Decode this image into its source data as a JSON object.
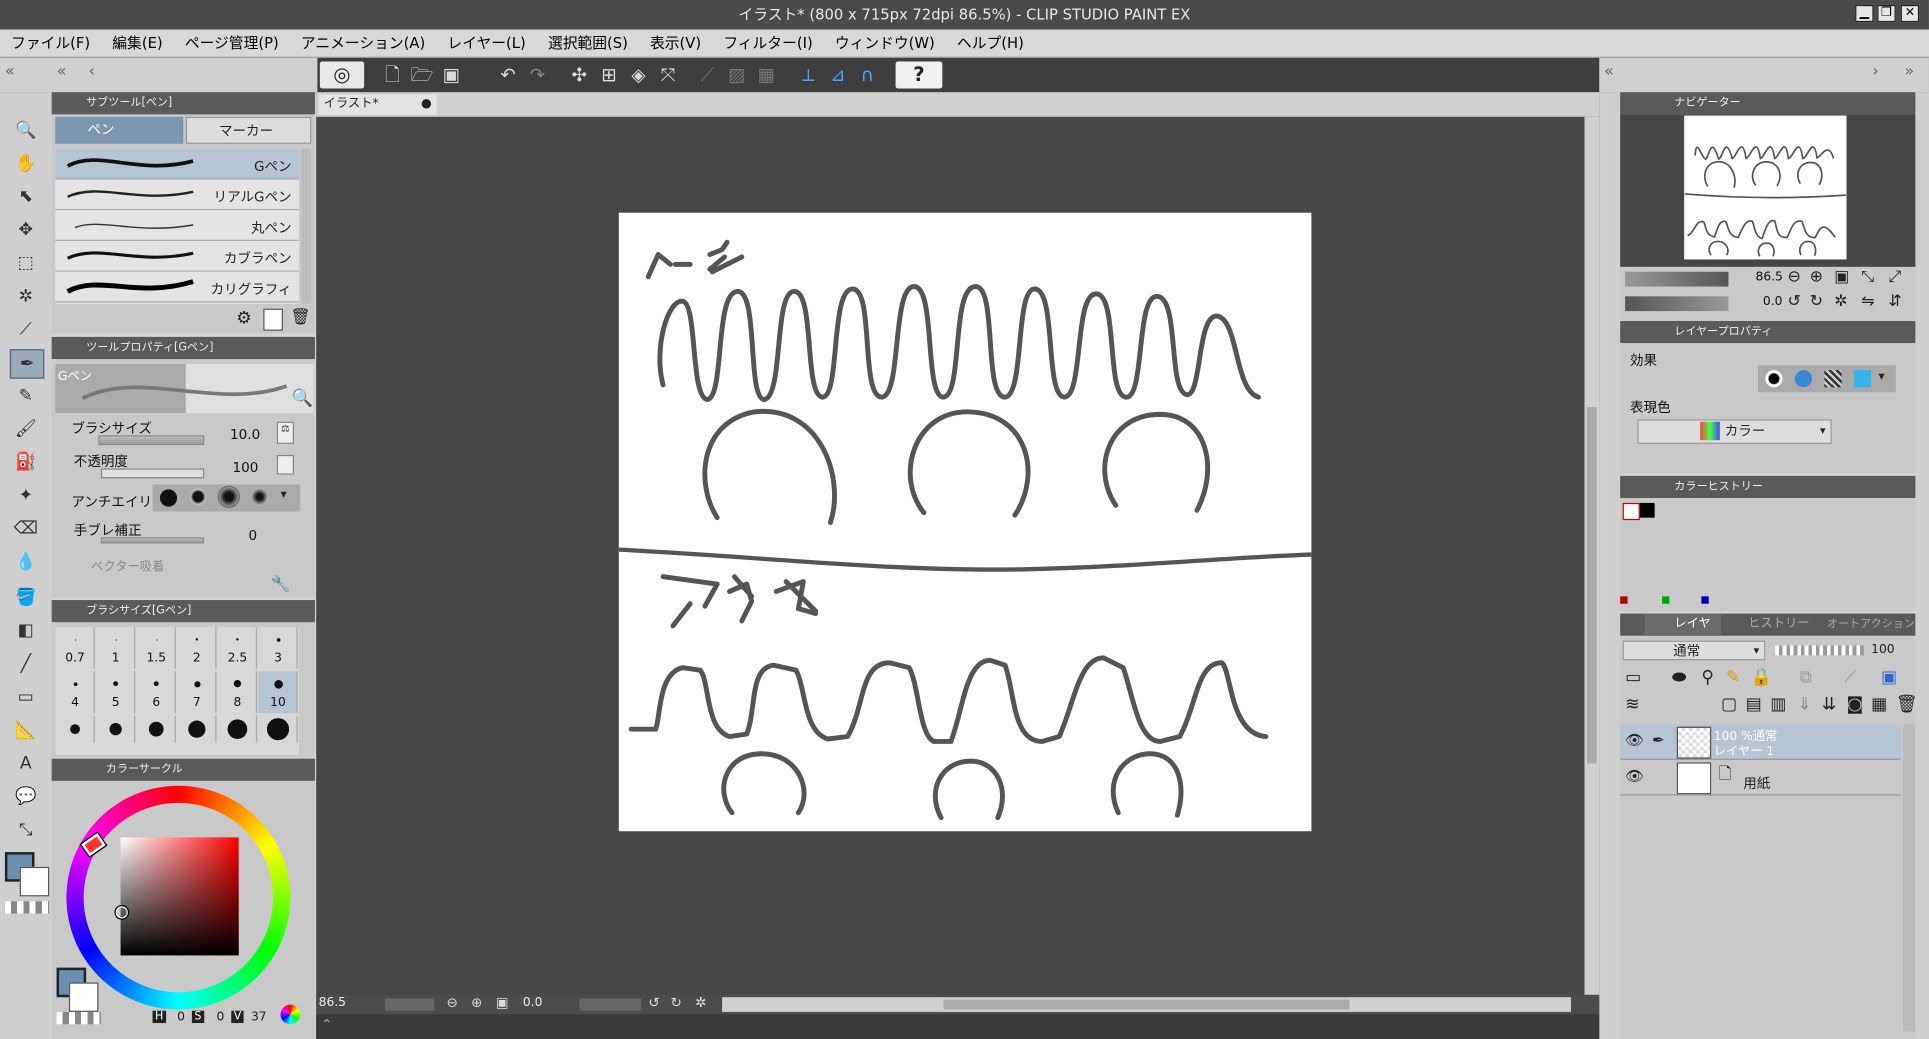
{
  "window": {
    "title": "イラスト* (800 x 715px 72dpi 86.5%)  - CLIP STUDIO PAINT EX"
  },
  "menu": [
    "ファイル(F)",
    "編集(E)",
    "ページ管理(P)",
    "アニメーション(A)",
    "レイヤー(L)",
    "選択範囲(S)",
    "表示(V)",
    "フィルター(I)",
    "ウィンドウ(W)",
    "ヘルプ(H)"
  ],
  "subtool": {
    "header": "サブツール[ペン]",
    "tab_pen": "ペン",
    "tab_marker": "マーカー",
    "brushes": [
      "Gペン",
      "リアルGペン",
      "丸ペン",
      "カブラペン",
      "カリグラフィ"
    ]
  },
  "toolprop": {
    "header": "ツールプロパティ[Gペン]",
    "preview_label": "Gペン",
    "brush_size_label": "ブラシサイズ",
    "brush_size_value": "10.0",
    "opacity_label": "不透明度",
    "opacity_value": "100",
    "antialias_label": "アンチエイリアス",
    "stabilize_label": "手ブレ補正",
    "stabilize_value": "0",
    "vector_label": "ベクター吸着"
  },
  "brushsize": {
    "header": "ブラシサイズ[Gペン]",
    "row1": [
      "0.7",
      "1",
      "1.5",
      "2",
      "2.5",
      "3"
    ],
    "row2": [
      "4",
      "5",
      "6",
      "7",
      "8",
      "10"
    ]
  },
  "colorcircle": {
    "header": "カラーサークル",
    "h_label": "H",
    "h_value": "0",
    "s_label": "S",
    "s_value": "0",
    "v_label": "V",
    "v_value": "37"
  },
  "canvas": {
    "tab": "イラスト*",
    "zoom": "86.5",
    "angle": "0.0",
    "drawing_text_pen": "ペン",
    "drawing_text_mouse": "マウス"
  },
  "navigator": {
    "header": "ナビゲーター",
    "zoom": "86.5",
    "angle": "0.0"
  },
  "layerprop": {
    "header": "レイヤープロパティ",
    "effect_label": "効果",
    "color_label": "表現色",
    "color_value": "カラー"
  },
  "colorhistory": {
    "header": "カラーヒストリー"
  },
  "layers": {
    "tab_layer": "レイヤー",
    "tab_history": "ヒストリー",
    "tab_autoaction": "オートアクション",
    "blend_mode": "通常",
    "opacity": "100",
    "items": [
      {
        "line1": "100 %通常",
        "line2": "レイヤー 1"
      },
      {
        "line1": "用紙",
        "line2": ""
      }
    ]
  },
  "colors": {
    "accent": "#6a8fb0",
    "canvas_bg": "#474747",
    "stroke": "#555555"
  }
}
